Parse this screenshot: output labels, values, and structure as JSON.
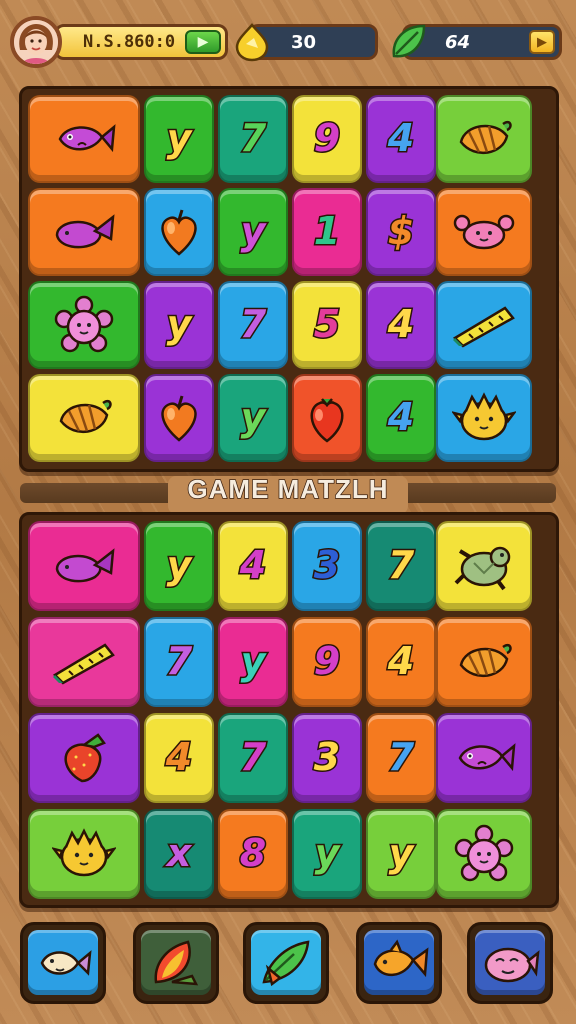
{
  "hud": {
    "money": "N.S.860:0",
    "gems": "30",
    "leaves": "64"
  },
  "title": "GAME MATZLH",
  "palette": {
    "orange": "#f57a1f",
    "green": "#33b82e",
    "teal": "#1aa57c",
    "yellow": "#f3e23a",
    "purple": "#9a33d6",
    "blue": "#2aa6e6",
    "pink": "#ea2c93",
    "lime": "#77cf3b",
    "red": "#f0532a",
    "dark-teal": "#168a73",
    "magenta": "#e9389b"
  },
  "board_top": [
    [
      {
        "c": "orange",
        "t": "fish-icon"
      },
      {
        "c": "green",
        "g": "y",
        "fc": "#ffd84a"
      },
      {
        "c": "teal",
        "g": "7",
        "fc": "#58d35a"
      },
      {
        "c": "yellow",
        "g": "9",
        "fc": "#d43fc8"
      },
      {
        "c": "purple",
        "g": "4",
        "fc": "#46a3f0"
      },
      {
        "c": "lime",
        "t": "shell-icon"
      }
    ],
    [
      {
        "c": "orange",
        "t": "whale-icon"
      },
      {
        "c": "blue",
        "t": "heart-fruit-icon"
      },
      {
        "c": "green",
        "g": "y",
        "fc": "#ce52d6"
      },
      {
        "c": "pink",
        "g": "1",
        "fc": "#2fc58a"
      },
      {
        "c": "purple",
        "g": "$",
        "fc": "#f28a2a"
      },
      {
        "c": "orange",
        "t": "crab-icon"
      }
    ],
    [
      {
        "c": "green",
        "t": "flower-creature-icon"
      },
      {
        "c": "purple",
        "g": "y",
        "fc": "#ffd84a"
      },
      {
        "c": "blue",
        "g": "7",
        "fc": "#c45ee0"
      },
      {
        "c": "yellow",
        "g": "5",
        "fc": "#e33c9a"
      },
      {
        "c": "purple",
        "g": "4",
        "fc": "#ffd84a"
      },
      {
        "c": "blue",
        "t": "ruler-icon"
      }
    ],
    [
      {
        "c": "yellow",
        "t": "shell-icon"
      },
      {
        "c": "purple",
        "t": "heart-fruit-icon"
      },
      {
        "c": "teal",
        "g": "y",
        "fc": "#6bd95a"
      },
      {
        "c": "red",
        "t": "berry-icon"
      },
      {
        "c": "green",
        "g": "4",
        "fc": "#46a3f0"
      },
      {
        "c": "blue",
        "t": "chick-icon"
      }
    ]
  ],
  "board_bottom": [
    [
      {
        "c": "pink",
        "t": "whale-icon"
      },
      {
        "c": "green",
        "g": "y",
        "fc": "#ffd84a"
      },
      {
        "c": "yellow",
        "g": "4",
        "fc": "#d43fc8"
      },
      {
        "c": "blue",
        "g": "3",
        "fc": "#2d5fd6"
      },
      {
        "c": "dark-teal",
        "g": "7",
        "fc": "#ffd84a"
      },
      {
        "c": "yellow",
        "t": "turtle-icon"
      }
    ],
    [
      {
        "c": "magenta",
        "t": "ruler-icon"
      },
      {
        "c": "blue",
        "g": "7",
        "fc": "#c45ee0"
      },
      {
        "c": "pink",
        "g": "y",
        "fc": "#3ad0b8"
      },
      {
        "c": "orange",
        "g": "9",
        "fc": "#d43fc8"
      },
      {
        "c": "orange",
        "g": "4",
        "fc": "#ffd84a"
      },
      {
        "c": "orange",
        "t": "shell-icon"
      }
    ],
    [
      {
        "c": "purple",
        "t": "strawberry-icon"
      },
      {
        "c": "yellow",
        "g": "4",
        "fc": "#f28a2a"
      },
      {
        "c": "teal",
        "g": "7",
        "fc": "#d43fc8"
      },
      {
        "c": "purple",
        "g": "3",
        "fc": "#ffd84a"
      },
      {
        "c": "orange",
        "g": "7",
        "fc": "#46a3f0"
      },
      {
        "c": "purple",
        "t": "fish-icon"
      }
    ],
    [
      {
        "c": "lime",
        "t": "chick-icon"
      },
      {
        "c": "dark-teal",
        "g": "x",
        "fc": "#c45ee0"
      },
      {
        "c": "orange",
        "g": "8",
        "fc": "#d43fc8"
      },
      {
        "c": "teal",
        "g": "y",
        "fc": "#6bd95a"
      },
      {
        "c": "lime",
        "g": "y",
        "fc": "#ffd84a"
      },
      {
        "c": "lime",
        "t": "flower-creature-icon"
      }
    ]
  ],
  "powerups": [
    {
      "name": "candy-fish-icon",
      "bg": "#2c9fe4"
    },
    {
      "name": "flame-leaf-icon",
      "bg": "#3f5f3a"
    },
    {
      "name": "feather-leaf-icon",
      "bg": "#33b4e8"
    },
    {
      "name": "goldfish-icon",
      "bg": "#2d66c7"
    },
    {
      "name": "blob-fish-icon",
      "bg": "#3a5fc0"
    }
  ]
}
